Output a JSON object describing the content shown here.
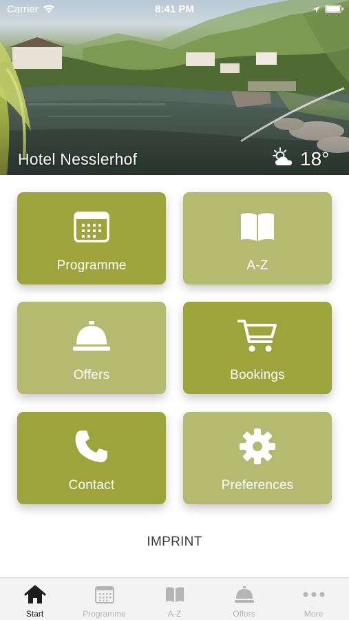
{
  "status_bar": {
    "carrier": "Carrier",
    "time": "8:41 PM"
  },
  "hero": {
    "hotel_name": "Hotel Nesslerhof",
    "temperature": "18°",
    "weather_icon": "sun-cloud-icon"
  },
  "tiles": [
    {
      "label": "Programme",
      "icon": "calendar-icon",
      "style": "dark"
    },
    {
      "label": "A-Z",
      "icon": "book-icon",
      "style": "light"
    },
    {
      "label": "Offers",
      "icon": "service-bell-icon",
      "style": "light"
    },
    {
      "label": "Bookings",
      "icon": "cart-icon",
      "style": "dark"
    },
    {
      "label": "Contact",
      "icon": "phone-icon",
      "style": "dark"
    },
    {
      "label": "Preferences",
      "icon": "gear-icon",
      "style": "light"
    }
  ],
  "imprint_label": "IMPRINT",
  "tab_bar": {
    "active_index": 0,
    "tabs": [
      {
        "label": "Start",
        "icon": "home-icon"
      },
      {
        "label": "Programme",
        "icon": "calendar-icon"
      },
      {
        "label": "A-Z",
        "icon": "book-icon"
      },
      {
        "label": "Offers",
        "icon": "service-bell-icon"
      },
      {
        "label": "More",
        "icon": "more-dots-icon"
      }
    ]
  },
  "colors": {
    "tile_dark": "#9ca43b",
    "tile_light": "#b4bb71",
    "tab_active": "#1c1c1c",
    "tab_inactive": "#b5b5b5"
  }
}
